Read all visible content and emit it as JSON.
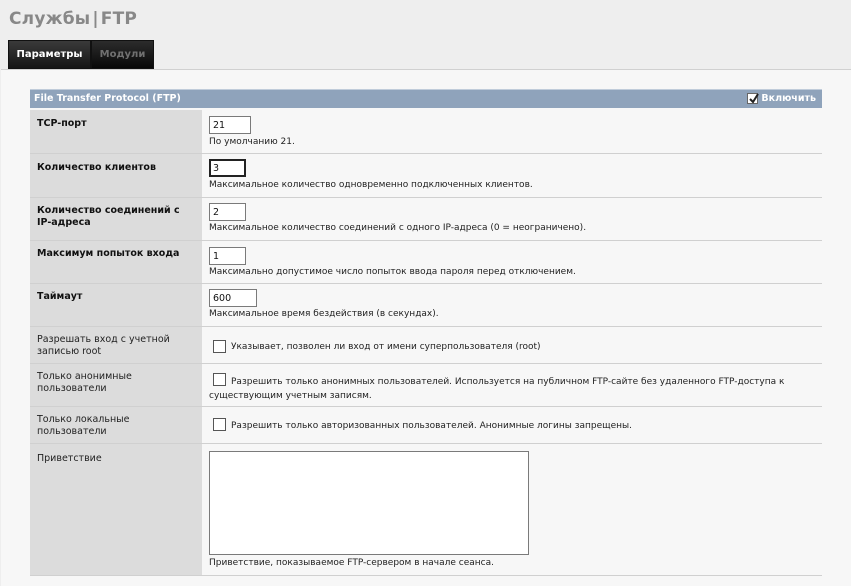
{
  "header": {
    "title_left": "Службы",
    "separator": "|",
    "title_right": "FTP"
  },
  "tabs": [
    {
      "label": "Параметры",
      "active": true
    },
    {
      "label": "Модули",
      "active": false
    }
  ],
  "section": {
    "title": "File Transfer Protocol (FTP)",
    "enable_label": "Включить",
    "enable_checked": true
  },
  "fields": {
    "tcp_port": {
      "label": "TCP-порт",
      "value": "21",
      "hint": "По умолчанию 21."
    },
    "max_clients": {
      "label": "Количество клиентов",
      "value": "3",
      "hint": "Максимальное количество одновременно подключенных клиентов."
    },
    "max_conn_ip": {
      "label": "Количество соединений с IP-адреса",
      "value": "2",
      "hint": "Максимальное количество соединений с одного IP-адреса (0 = неограничено)."
    },
    "max_login": {
      "label": "Максимум попыток входа",
      "value": "1",
      "hint": "Максимально допустимое число попыток ввода пароля перед отключением."
    },
    "timeout": {
      "label": "Таймаут",
      "value": "600",
      "hint": "Максимальное время бездействия (в секундах)."
    },
    "root_login": {
      "label": "Разрешать вход с учетной записью root",
      "text": "Указывает, позволен ли вход от имени суперпользователя (root)",
      "checked": false
    },
    "anon_only": {
      "label": "Только анонимные пользователи",
      "text": "Разрешить только анонимных пользователей. Используется на публичном FTP-сайте без удаленного FTP-доступа к существующим учетным записям.",
      "checked": false
    },
    "local_only": {
      "label": "Только локальные пользователи",
      "text": "Разрешить только авторизованных пользователей. Анонимные логины запрещены.",
      "checked": false
    },
    "banner": {
      "label": "Приветствие",
      "value": "",
      "hint": "Приветствие, показываемое FTP-сервером в начале сеанса."
    }
  },
  "colors": {
    "header_bar": "#8fa3bb",
    "label_bg": "#dcdcdc",
    "tab_active_bg": "#2a2a2a"
  }
}
